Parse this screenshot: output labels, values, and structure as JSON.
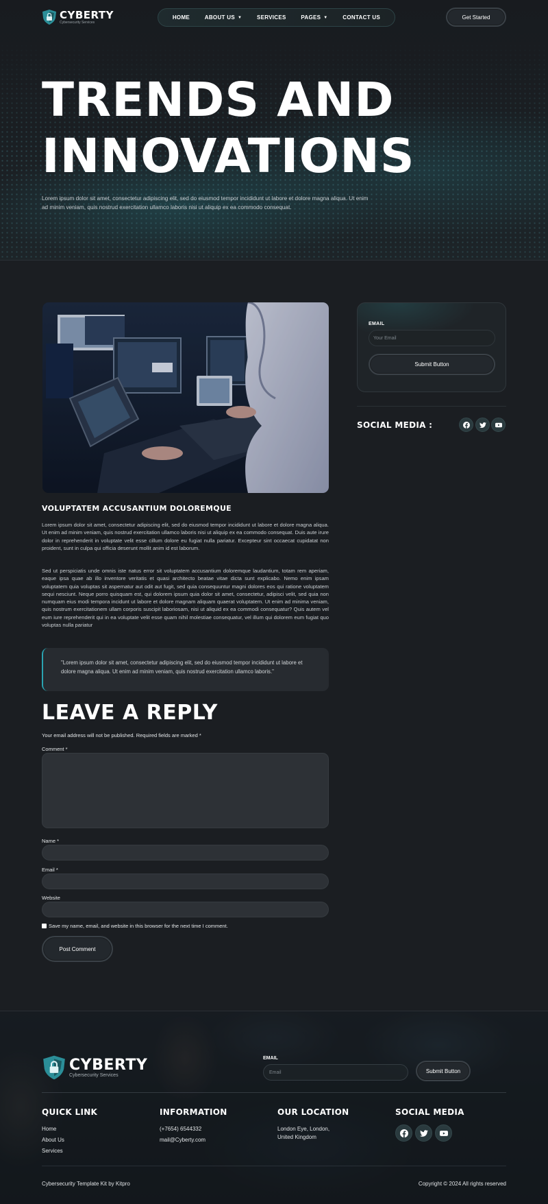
{
  "brand": {
    "name": "CYBERTY",
    "tagline": "Cybersecurity Services"
  },
  "nav": {
    "items": [
      {
        "label": "HOME",
        "dropdown": false
      },
      {
        "label": "ABOUT US",
        "dropdown": true
      },
      {
        "label": "SERVICES",
        "dropdown": false
      },
      {
        "label": "PAGES",
        "dropdown": true
      },
      {
        "label": "CONTACT US",
        "dropdown": false
      }
    ],
    "cta_label": "Get Started"
  },
  "hero": {
    "title_line1": "TRENDS AND",
    "title_line2": "INNOVATIONS",
    "text": "Lorem ipsum dolor sit amet, consectetur adipiscing elit, sed do eiusmod tempor incididunt ut labore et dolore magna aliqua. Ut enim ad minim veniam, quis nostrud exercitation ullamco laboris nisi ut aliquip ex ea commodo consequat."
  },
  "article": {
    "title": "VOLUPTATEM ACCUSANTIUM DOLOREMQUE",
    "paragraph_1": "Lorem ipsum dolor sit amet, consectetur adipiscing elit, sed do eiusmod tempor incididunt ut labore et dolore magna aliqua. Ut enim ad minim veniam, quis nostrud exercitation ullamco laboris nisi ut aliquip ex ea commodo consequat. Duis aute irure dolor in reprehenderit in voluptate velit esse cillum dolore eu fugiat nulla pariatur. Excepteur sint occaecat cupidatat non proident, sunt in culpa qui officia deserunt mollit anim id est laborum.",
    "paragraph_2": "Sed ut perspiciatis unde omnis iste natus error sit voluptatem accusantium doloremque laudantium, totam rem aperiam, eaque ipsa quae ab illo inventore veritatis et quasi architecto beatae vitae dicta sunt explicabo. Nemo enim ipsam voluptatem quia voluptas sit aspernatur aut odit aut fugit, sed quia consequuntur magni dolores eos qui ratione voluptatem sequi nesciunt. Neque porro quisquam est, qui dolorem ipsum quia dolor sit amet, consectetur, adipisci velit, sed quia non numquam eius modi tempora incidunt ut labore et dolore magnam aliquam quaerat voluptatem. Ut enim ad minima veniam, quis nostrum exercitationem ullam corporis suscipit laboriosam, nisi ut aliquid ex ea commodi consequatur? Quis autem vel eum iure reprehenderit qui in ea voluptate velit esse quam nihil molestiae consequatur, vel illum qui dolorem eum fugiat quo voluptas nulla pariatur",
    "quote": "\"Lorem ipsum dolor sit amet, consectetur adipiscing elit, sed do eiusmod tempor incididunt ut labore et dolore magna aliqua. Ut enim ad minim veniam, quis nostrud exercitation ullamco laboris.\""
  },
  "reply": {
    "title": "LEAVE A REPLY",
    "note": "Your email address will not be published. Required fields are marked *",
    "comment_label": "Comment *",
    "name_label": "Name *",
    "email_label": "Email *",
    "website_label": "Website",
    "checkbox_label": "Save my name, email, and website in this browser for the next time I comment.",
    "submit_label": "Post Comment"
  },
  "sidebar": {
    "email_label": "EMAIL",
    "email_placeholder": "Your Email",
    "submit_label": "Submit Button",
    "social_title": "SOCIAL MEDIA :",
    "social_icons": [
      "facebook-icon",
      "twitter-icon",
      "youtube-icon"
    ]
  },
  "footer": {
    "email_label": "EMAIL",
    "email_placeholder": "Email",
    "submit_label": "Submit Button",
    "quick_link": {
      "title": "QUICK LINK",
      "links": [
        "Home",
        "About Us",
        "Services"
      ]
    },
    "information": {
      "title": "INFORMATION",
      "phone": "(+7654) 6544332",
      "email": "mail@Cyberty.com"
    },
    "location": {
      "title": "OUR LOCATION",
      "line1": "London Eye, London,",
      "line2": "United Kingdom"
    },
    "social": {
      "title": "SOCIAL MEDIA"
    },
    "credit": "Cybersecurity Template Kit by Kitpro",
    "copyright": "Copyright © 2024 All rights reserved"
  },
  "colors": {
    "accent": "#2aa3b0",
    "background": "#1b1e22",
    "panel": "#2d3136"
  }
}
